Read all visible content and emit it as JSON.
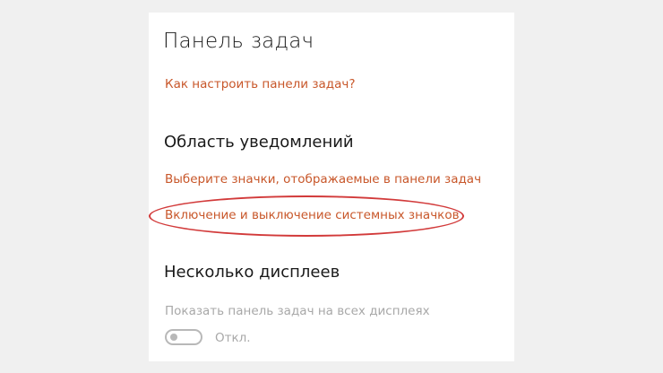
{
  "page": {
    "title": "Панель задач"
  },
  "links": {
    "howto": "Как настроить панели задач?"
  },
  "notifications": {
    "title": "Область уведомлений",
    "select_icons_link": "Выберите значки, отображаемые в панели задач",
    "system_icons_link": "Включение и выключение системных значков"
  },
  "displays": {
    "title": "Несколько дисплеев",
    "show_on_all_label": "Показать панель задач на всех дисплеях",
    "toggle_state": "Откл.",
    "toggle_on": false,
    "toggle_enabled": false
  },
  "colors": {
    "link": "#c8572a",
    "highlight": "#d23a3a",
    "disabled_text": "#a8a8a8"
  }
}
